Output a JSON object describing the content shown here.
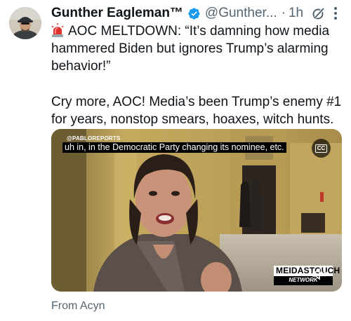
{
  "tweet": {
    "author_name": "Gunther Eagleman™",
    "handle": "@Gunther...",
    "separator": "·",
    "time": "1h",
    "text_line1": "AOC MELTDOWN: “It’s damning how media hammered Biden but ignores Trump’s alarming behavior!”",
    "text_line2": "Cry more, AOC! Media’s been Trump’s enemy #1 for years, nonstop smears, hoaxes, witch hunts.",
    "icons": {
      "verified": "verified-badge-icon",
      "grok": "grok-icon",
      "more": "more-icon",
      "siren": "siren-emoji-icon"
    }
  },
  "video": {
    "watermark": "@PABLOREPORTS",
    "caption": "uh in, in the Democratic Party changing its nominee, etc.",
    "cc_label": "CC",
    "logo_top": "MEIDASTOUCH",
    "logo_bottom": "NETWORK"
  },
  "attribution": "From Acyn",
  "colors": {
    "text": "#0f1419",
    "secondary": "#536471",
    "verified": "#1d9bf0"
  }
}
